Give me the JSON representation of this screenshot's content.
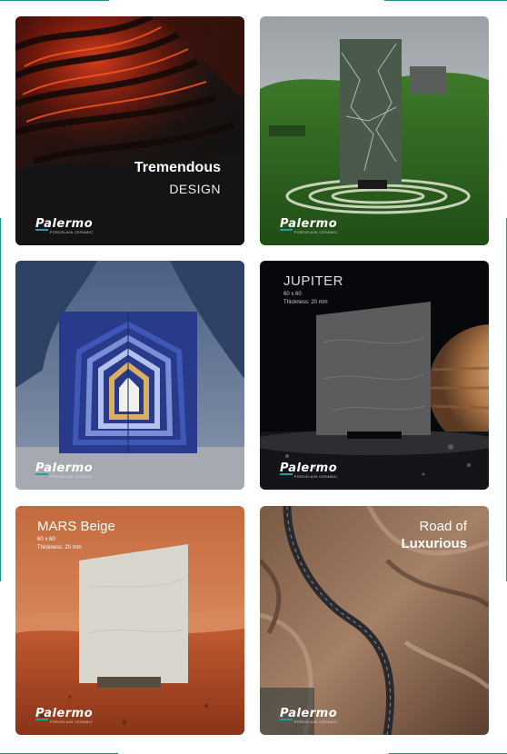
{
  "brand": {
    "logo_text": "Palermo",
    "tagline": "porcelain ceramic"
  },
  "tiles": [
    {
      "caption_line1": "Tremendous",
      "caption_line2": "DESIGN"
    },
    {},
    {},
    {
      "title": "JUPITER",
      "size": "60 x 60",
      "thickness": "Thickness: 20 mm"
    },
    {
      "title": "MARS Beige",
      "size": "60 x 60",
      "thickness": "Thickness: 20 mm"
    },
    {
      "caption_line1": "Road of",
      "caption_line2": "Luxurious"
    }
  ],
  "colors": {
    "accent": "#1f8f86",
    "logo_bar": "#19a3a0"
  }
}
